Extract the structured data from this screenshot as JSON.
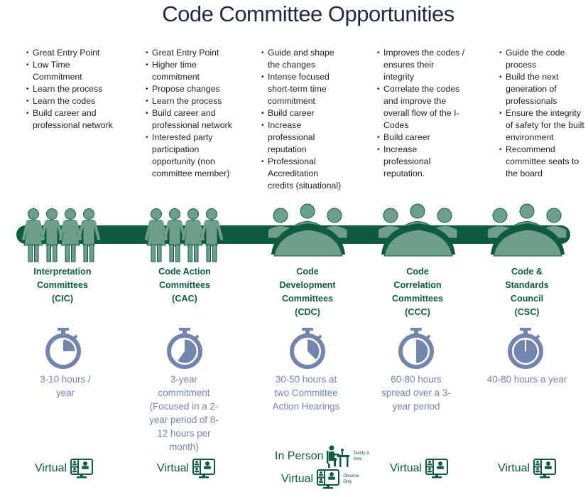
{
  "title": "Code Committee Opportunities",
  "colors": {
    "green": "#0f5b3f",
    "figure": "#6e9f8b",
    "timer": "#7384ad",
    "title": "#222a3f"
  },
  "committees": [
    {
      "name_lines": [
        "Interpretation",
        "Committees",
        "(CIC)"
      ],
      "icon": "people-holding-hands-icon",
      "bullets": [
        "Great Entry Point",
        "Low Time Commitment",
        "Learn the process",
        "Learn the codes",
        "Build career and professional network"
      ],
      "time_fraction": 0.25,
      "time_text": "3-10 hours / year",
      "participation": [
        {
          "label": "Virtual",
          "icon": "virtual-meeting-icon",
          "note": ""
        }
      ]
    },
    {
      "name_lines": [
        "Code Action",
        "Committees",
        "(CAC)"
      ],
      "icon": "people-holding-hands-icon",
      "bullets": [
        "Great Entry Point",
        "Higher time commitment",
        "Propose changes",
        "Learn the process",
        "Build career and professional network",
        "Interested party participation opportunity (non committee member)"
      ],
      "time_fraction": 0.6,
      "time_text": "3-year commitment (Focused in a 2-year period of 8-12 hours per month)",
      "participation": [
        {
          "label": "Virtual",
          "icon": "virtual-meeting-icon",
          "note": ""
        }
      ]
    },
    {
      "name_lines": [
        "Code",
        "Development",
        "Committees",
        "(CDC)"
      ],
      "icon": "meeting-table-icon",
      "bullets": [
        "Guide and shape the changes",
        "Intense focused short-term time commitment",
        "Build career",
        "Increase professional reputation",
        "Professional Accreditation credits (situational)"
      ],
      "time_fraction": 0.375,
      "time_text": "30-50 hours at two Committee Action Hearings",
      "participation": [
        {
          "label": "In Person",
          "icon": "person-at-desk-icon",
          "note": "Testify & Vote"
        },
        {
          "label": "Virtual",
          "icon": "virtual-meeting-icon",
          "note": "Observe Only"
        }
      ]
    },
    {
      "name_lines": [
        "Code",
        "Correlation",
        "Committees",
        "(CCC)"
      ],
      "icon": "meeting-table-icon",
      "bullets": [
        "Improves the codes / ensures their integrity",
        "Correlate the codes and improve the overall flow of the I-Codes",
        "Build career",
        "Increase professional reputation."
      ],
      "time_fraction": 0.5,
      "time_text": "60-80 hours spread over a 3-year period",
      "participation": [
        {
          "label": "Virtual",
          "icon": "virtual-meeting-icon",
          "note": ""
        }
      ]
    },
    {
      "name_lines": [
        "Code &",
        "Standards",
        "Council",
        "(CSC)"
      ],
      "icon": "meeting-table-icon",
      "bullets": [
        "Guide the code process",
        "Build the next generation of professionals",
        "Ensure the integrity of safety for the built environment",
        "Recommend committee seats to the board"
      ],
      "time_fraction": 1.0,
      "time_text": "40-80 hours a year",
      "participation": [
        {
          "label": "Virtual",
          "icon": "virtual-meeting-icon",
          "note": ""
        }
      ]
    }
  ]
}
